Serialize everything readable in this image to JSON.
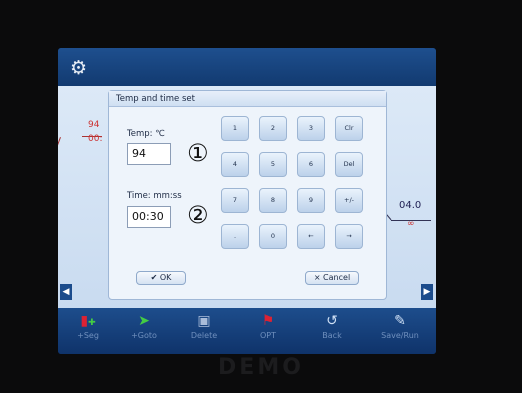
{
  "dialog": {
    "title": "Temp and time set",
    "temp_label": "Temp: ℃",
    "temp_value": "94",
    "time_label": "Time: mm:ss",
    "time_value": "00:30",
    "callout_temp": "①",
    "callout_time": "②",
    "ok_label": "✔ OK",
    "cancel_label": "× Cancel"
  },
  "keypad": {
    "rows": [
      [
        "1",
        "2",
        "3",
        "Clr"
      ],
      [
        "4",
        "5",
        "6",
        "Del"
      ],
      [
        "7",
        "8",
        "9",
        "+/-"
      ],
      [
        ".",
        "0",
        "←",
        "→"
      ]
    ]
  },
  "graph": {
    "left_segment_temp": "94",
    "left_segment_time": "00:",
    "right_segment_temp": "04.0",
    "right_segment_time": "∞"
  },
  "toolbar": {
    "items": [
      {
        "label": "+Seg",
        "icon": "add-segment-icon"
      },
      {
        "label": "+Goto",
        "icon": "goto-icon"
      },
      {
        "label": "Delete",
        "icon": "trash-icon"
      },
      {
        "label": "OPT",
        "icon": "options-icon"
      },
      {
        "label": "Back",
        "icon": "back-icon"
      },
      {
        "label": "Save/Run",
        "icon": "save-run-icon"
      }
    ]
  },
  "device": {
    "brand": "DEMO"
  },
  "colors": {
    "accent": "#1d4d8c",
    "segment": "#cc3333"
  }
}
